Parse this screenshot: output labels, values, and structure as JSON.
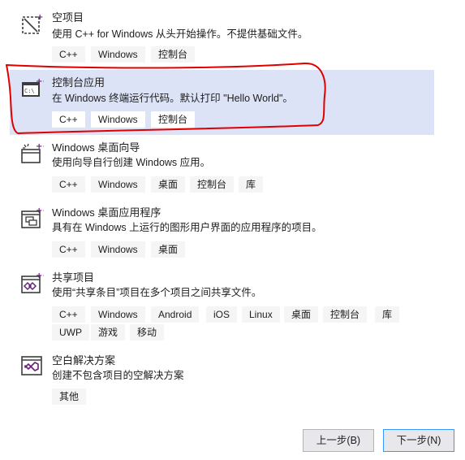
{
  "templates": [
    {
      "id": "empty-project",
      "title": "空项目",
      "description": "使用 C++ for Windows 从头开始操作。不提供基础文件。",
      "tags": [
        "C++",
        "Windows",
        "控制台"
      ],
      "icon": "empty-project-icon",
      "selected": false
    },
    {
      "id": "console-app",
      "title": "控制台应用",
      "description": "在 Windows 终端运行代码。默认打印 \"Hello World\"。",
      "tags": [
        "C++",
        "Windows",
        "控制台"
      ],
      "icon": "console-app-icon",
      "selected": true
    },
    {
      "id": "windows-desktop-wizard",
      "title": "Windows 桌面向导",
      "description": "使用向导自行创建 Windows 应用。",
      "tags": [
        "C++",
        "Windows",
        "桌面",
        "控制台",
        "库"
      ],
      "icon": "desktop-wizard-icon",
      "selected": false
    },
    {
      "id": "windows-desktop-app",
      "title": "Windows 桌面应用程序",
      "description": "具有在 Windows 上运行的图形用户界面的应用程序的项目。",
      "tags": [
        "C++",
        "Windows",
        "桌面"
      ],
      "icon": "desktop-app-icon",
      "selected": false
    },
    {
      "id": "shared-items",
      "title": "共享项目",
      "description": "使用“共享条目”项目在多个项目之间共享文件。",
      "tags": [
        "C++",
        "Windows",
        "Android",
        "iOS",
        "Linux",
        "桌面",
        "控制台",
        "库",
        "UWP",
        "游戏",
        "移动"
      ],
      "icon": "shared-items-icon",
      "selected": false
    },
    {
      "id": "blank-solution",
      "title": "空白解决方案",
      "description": "创建不包含项目的空解决方案",
      "tags": [
        "其他"
      ],
      "icon": "blank-solution-icon",
      "selected": false
    }
  ],
  "footer": {
    "back_label": "上一步(B)",
    "next_label": "下一步(N)"
  },
  "colors": {
    "selection": "#dde3f7",
    "tag_bg": "#f5f5f5",
    "accent_purple": "#68217a",
    "annotation_red": "#e00000",
    "primary_border": "#3399ff"
  }
}
